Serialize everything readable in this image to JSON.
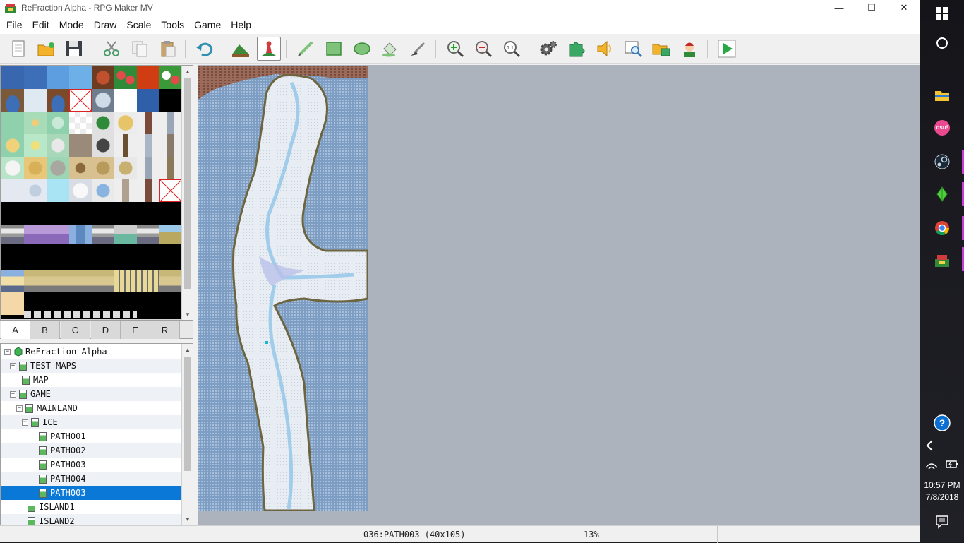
{
  "window": {
    "title": "ReFraction Alpha - RPG Maker MV",
    "minimize": "—",
    "maximize": "☐",
    "close": "✕"
  },
  "menu": [
    "File",
    "Edit",
    "Mode",
    "Draw",
    "Scale",
    "Tools",
    "Game",
    "Help"
  ],
  "toolbar": {
    "buttons": [
      "new-project",
      "open-project",
      "save-project",
      "cut",
      "copy",
      "paste",
      "undo",
      "map-mode",
      "event-mode",
      "pencil",
      "rectangle",
      "ellipse",
      "flood-fill",
      "shadow-pen",
      "zoom-in",
      "zoom-out",
      "actual-size",
      "database",
      "plugin-manager",
      "sound-test",
      "event-searcher",
      "resource-manager",
      "character-generator",
      "playtest"
    ],
    "active": "event-mode"
  },
  "tileset_tabs": [
    "A",
    "B",
    "C",
    "D",
    "E",
    "R"
  ],
  "active_tab": "A",
  "map_tree": [
    {
      "label": "ReFraction Alpha",
      "depth": 0,
      "expander": "⊟",
      "kind": "project"
    },
    {
      "label": "TEST MAPS",
      "depth": 1,
      "expander": "+",
      "kind": "map"
    },
    {
      "label": "MAP",
      "depth": 1,
      "expander": "",
      "kind": "map"
    },
    {
      "label": "GAME",
      "depth": 1,
      "expander": "−",
      "kind": "map"
    },
    {
      "label": "MAINLAND",
      "depth": 2,
      "expander": "−",
      "kind": "map"
    },
    {
      "label": "ICE",
      "depth": 3,
      "expander": "−",
      "kind": "map"
    },
    {
      "label": "PATH001",
      "depth": 4,
      "expander": "",
      "kind": "map"
    },
    {
      "label": "PATH002",
      "depth": 4,
      "expander": "",
      "kind": "map"
    },
    {
      "label": "PATH003",
      "depth": 4,
      "expander": "",
      "kind": "map"
    },
    {
      "label": "PATH004",
      "depth": 4,
      "expander": "",
      "kind": "map"
    },
    {
      "label": "PATH003",
      "depth": 4,
      "expander": "",
      "kind": "map",
      "selected": true
    },
    {
      "label": "ISLAND1",
      "depth": 2,
      "expander": "",
      "kind": "map"
    },
    {
      "label": "ISLAND2",
      "depth": 2,
      "expander": "",
      "kind": "map"
    }
  ],
  "status": {
    "map_info": "036:PATH003 (40x105)",
    "zoom": "13%"
  },
  "taskbar": {
    "time": "10:57 PM",
    "date": "7/8/2018",
    "osu_label": "osu!"
  },
  "colors": {
    "selection": "#0a78d7",
    "canvas_bg": "#adb3bc",
    "water": "#7d9ec2",
    "snow": "#e6ecf2",
    "cliff": "#7a6a4a"
  }
}
